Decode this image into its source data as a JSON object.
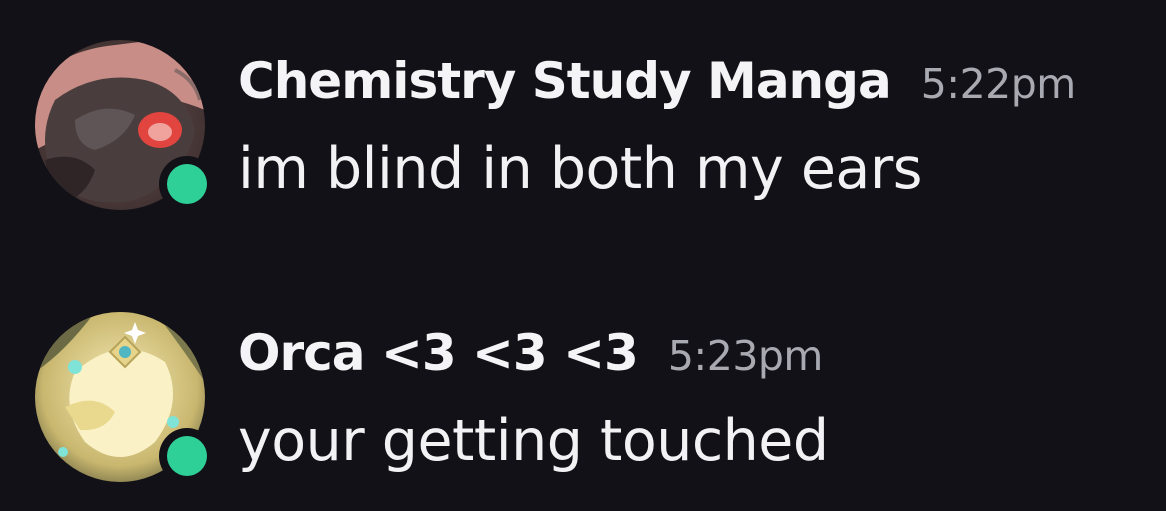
{
  "messages": [
    {
      "author": "Chemistry Study Manga",
      "time": "5:22pm",
      "text": "im blind in both my ears",
      "status": "online"
    },
    {
      "author": "Orca <3 <3 <3",
      "time": "5:23pm",
      "text": "your getting touched",
      "status": "online"
    }
  ],
  "colors": {
    "background": "#121117",
    "online": "#2fd097",
    "timestamp": "#a9a9b2",
    "text": "#f2f2f5"
  }
}
